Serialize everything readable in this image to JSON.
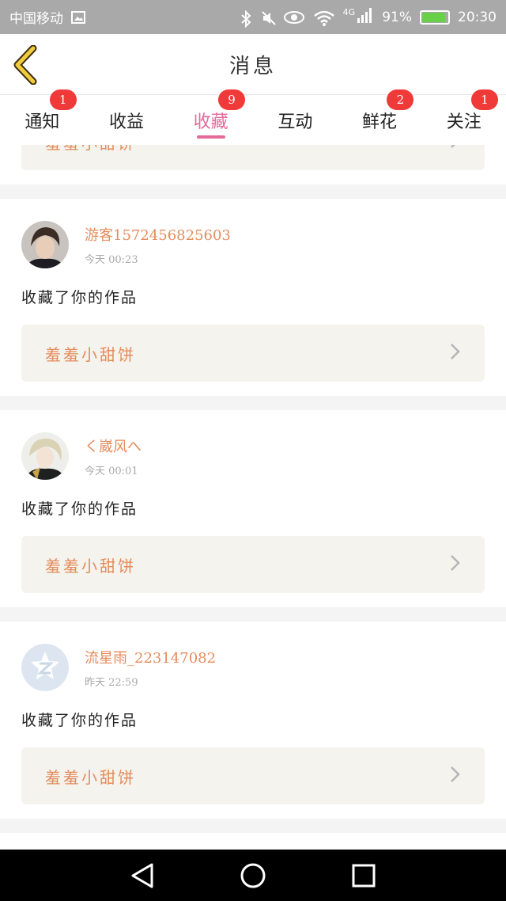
{
  "status_bar": {
    "carrier": "中国移动",
    "network": "4G",
    "battery": "91%",
    "battery_level": 0.91,
    "time": "20:30"
  },
  "header": {
    "title": "消息"
  },
  "tabs": [
    {
      "label": "通知",
      "badge": "1",
      "active": false
    },
    {
      "label": "收益",
      "badge": "",
      "active": false
    },
    {
      "label": "收藏",
      "badge": "9",
      "active": true
    },
    {
      "label": "互动",
      "badge": "",
      "active": false
    },
    {
      "label": "鲜花",
      "badge": "2",
      "active": false
    },
    {
      "label": "关注",
      "badge": "1",
      "active": false
    }
  ],
  "feed": {
    "partial_top": {
      "work_title": "羞羞小甜饼"
    },
    "items": [
      {
        "username": "游客1572456825603",
        "time": "今天 00:23",
        "action": "收藏了你的作品",
        "work_title": "羞羞小甜饼"
      },
      {
        "username": "く崴风へ",
        "time": "今天 00:01",
        "action": "收藏了你的作品",
        "work_title": "羞羞小甜饼"
      },
      {
        "username": "流星雨_223147082",
        "time": "昨天 22:59",
        "action": "收藏了你的作品",
        "work_title": "羞羞小甜饼"
      }
    ]
  },
  "colors": {
    "accent": "#e46a9a",
    "username": "#e58c5b",
    "badge": "#f03a3a"
  },
  "icons": {
    "back": "chevron-left-icon",
    "nav_back": "triangle-back-icon",
    "nav_home": "circle-home-icon",
    "nav_recent": "square-recent-icon"
  }
}
